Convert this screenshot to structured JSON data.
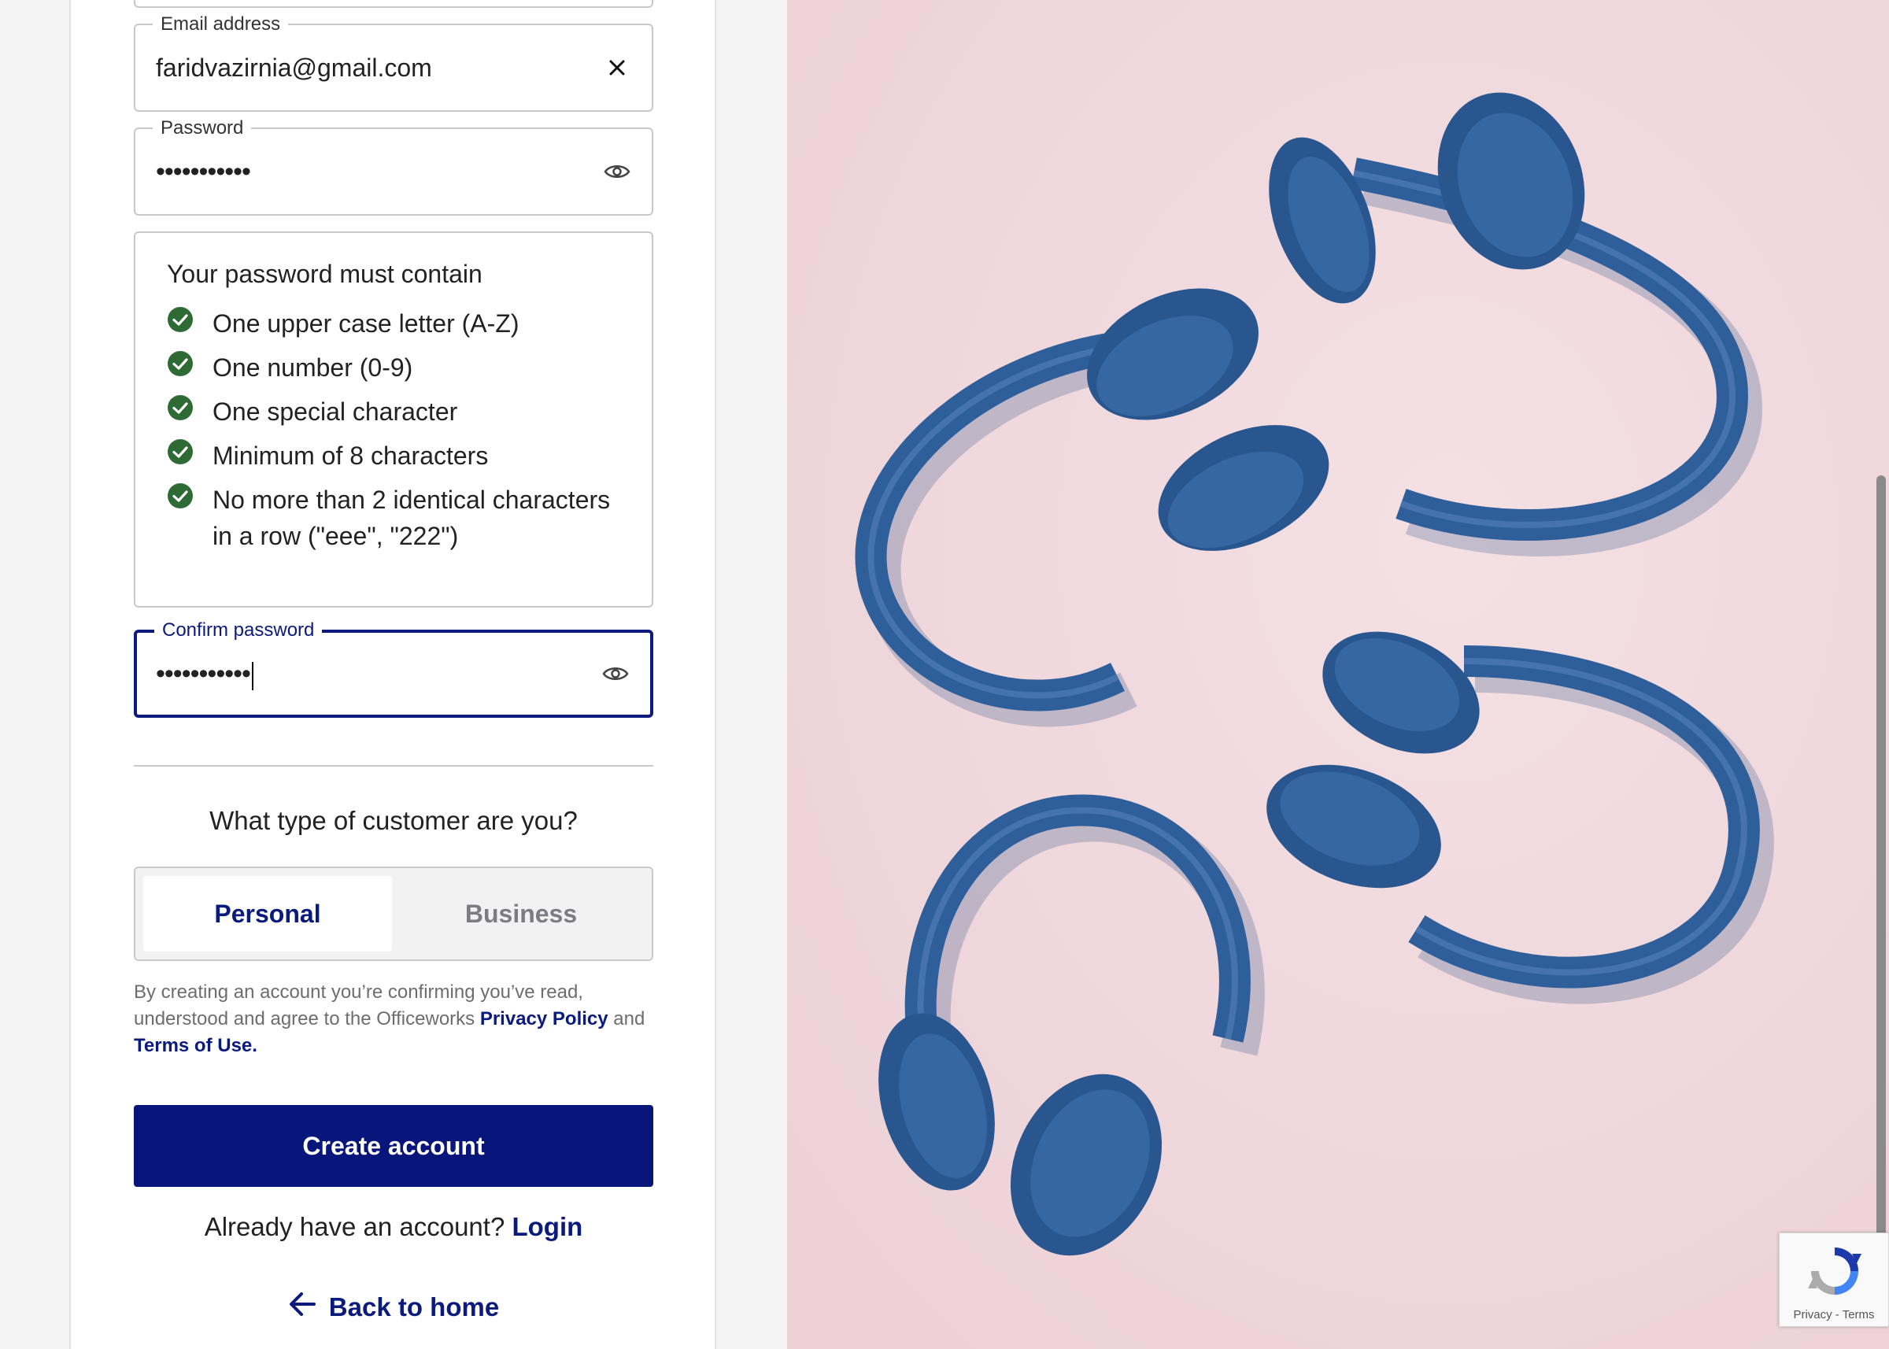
{
  "form": {
    "email": {
      "label": "Email address",
      "value": "faridvazirnia@gmail.com"
    },
    "password": {
      "label": "Password",
      "masked_value": "•••••••••••"
    },
    "rules": {
      "title": "Your password must contain",
      "items": [
        {
          "text": "One upper case letter (A-Z)",
          "met": true
        },
        {
          "text": "One number (0-9)",
          "met": true
        },
        {
          "text": "One special character",
          "met": true
        },
        {
          "text": "Minimum of 8 characters",
          "met": true
        },
        {
          "text": "No more than 2 identical characters in a row (\"eee\", \"222\")",
          "met": true
        }
      ]
    },
    "confirm": {
      "label": "Confirm password",
      "masked_value": "•••••••••••"
    },
    "customer_question": "What type of customer are you?",
    "customer_types": {
      "personal": "Personal",
      "business": "Business",
      "selected": "Personal"
    },
    "legal": {
      "prefix": "By creating an account you’re confirming you’ve read, understood and agree to the Officeworks ",
      "privacy_link": "Privacy Policy",
      "middle": " and ",
      "terms_link": "Terms of Use."
    },
    "create_button": "Create account",
    "already_text": "Already have an account? ",
    "login_link": "Login",
    "back_link": "Back to home"
  },
  "recaptcha": {
    "privacy": "Privacy",
    "separator": " - ",
    "terms": "Terms"
  },
  "colors": {
    "brand_navy": "#08167c",
    "check_green": "#2e6b34",
    "photo_background": "#f1d9de",
    "headphone_blue": "#2f5f9a"
  },
  "icons": {
    "email_clear": "close-icon",
    "password_toggle": "eye-icon",
    "rule_status": "check-circle-icon",
    "back": "arrow-left-icon",
    "captcha": "recaptcha-logo-icon"
  }
}
